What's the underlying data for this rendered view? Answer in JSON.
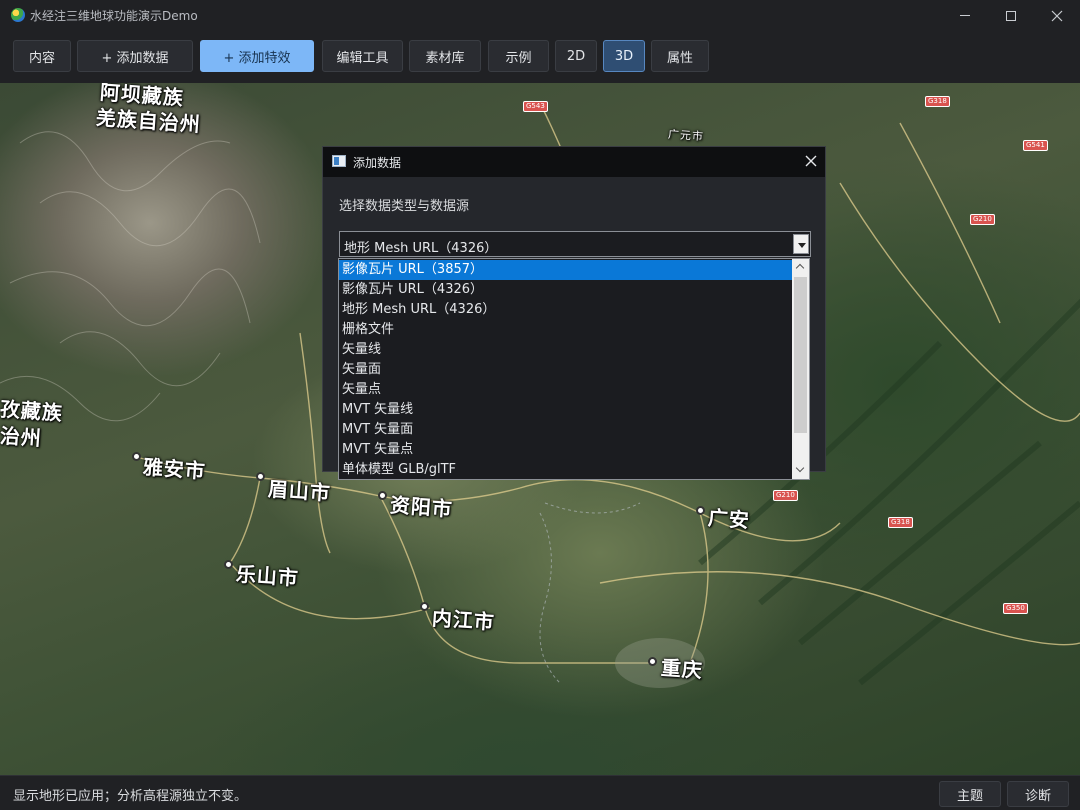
{
  "window": {
    "title": "水经注三维地球功能演示Demo",
    "controls": [
      "minimize-icon",
      "maximize-icon",
      "close-icon"
    ]
  },
  "toolbar": {
    "buttons": [
      {
        "label": "内容",
        "state": "normal"
      },
      {
        "label": "+ 添加数据",
        "state": "normal"
      },
      {
        "label": "+ 添加特效",
        "state": "primary"
      },
      {
        "label": "编辑工具",
        "state": "normal"
      },
      {
        "label": "素材库",
        "state": "normal"
      },
      {
        "label": "示例",
        "state": "normal"
      },
      {
        "label": "2D",
        "state": "normal"
      },
      {
        "label": "3D",
        "state": "active"
      },
      {
        "label": "属性",
        "state": "normal"
      }
    ]
  },
  "map": {
    "labels": [
      {
        "text": "阿坝藏族"
      },
      {
        "text": "羌族自治州"
      },
      {
        "text": "孜藏族"
      },
      {
        "text": "治州"
      },
      {
        "text": "雅安市"
      },
      {
        "text": "眉山市"
      },
      {
        "text": "资阳市"
      },
      {
        "text": "乐山市"
      },
      {
        "text": "内江市"
      },
      {
        "text": "重庆"
      },
      {
        "text": "广安"
      },
      {
        "text": "广元市"
      }
    ],
    "road_signs": [
      "G543",
      "G318",
      "G541",
      "G210",
      "G210",
      "G318",
      "G350"
    ]
  },
  "dialog": {
    "title": "添加数据",
    "prompt": "选择数据类型与数据源",
    "selected_value": "地形 Mesh URL（4326）",
    "options": [
      "影像瓦片 URL（3857）",
      "影像瓦片 URL（4326）",
      "地形 Mesh URL（4326）",
      "栅格文件",
      "矢量线",
      "矢量面",
      "矢量点",
      "MVT 矢量线",
      "MVT 矢量面",
      "MVT 矢量点",
      "单体模型 GLB/glTF"
    ],
    "highlighted_index": 0
  },
  "statusbar": {
    "message": "显示地形已应用；分析高程源独立不变。",
    "theme_label": "主题",
    "diagnose_label": "诊断"
  },
  "colors": {
    "accent": "#7db7f7",
    "active": "#2f4e73",
    "selection": "#0a78d7",
    "background": "#202124"
  }
}
